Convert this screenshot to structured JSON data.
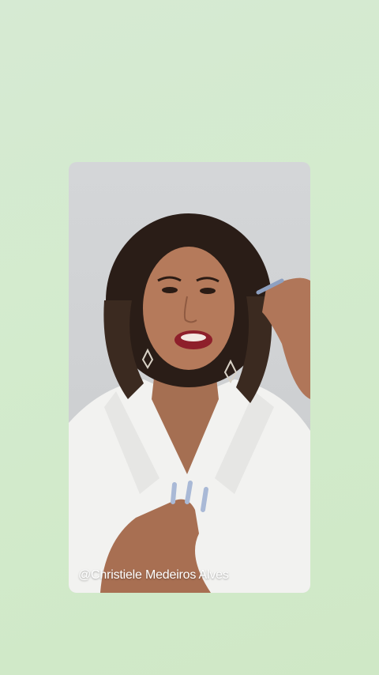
{
  "video": {
    "caption": "@Christiele Medeiros Alves"
  },
  "colors": {
    "background": "#d3ebcd",
    "video_backdrop": "#cfd1d3",
    "caption_text": "#ffffff"
  }
}
